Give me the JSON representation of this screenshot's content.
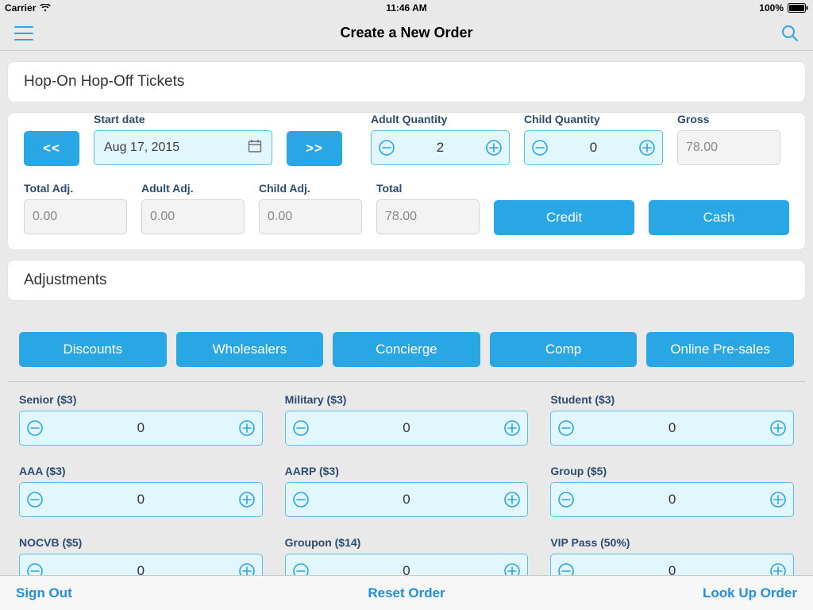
{
  "status": {
    "carrier": "Carrier",
    "time": "11:46 AM",
    "battery": "100%"
  },
  "nav": {
    "title": "Create a New Order"
  },
  "ticketsCard": {
    "title": "Hop-On Hop-Off Tickets",
    "labels": {
      "start_date": "Start date",
      "adult_qty": "Adult Quantity",
      "child_qty": "Child Quantity",
      "gross": "Gross",
      "total_adj": "Total Adj.",
      "adult_adj": "Adult Adj.",
      "child_adj": "Child Adj.",
      "total": "Total",
      "credit": "Credit",
      "cash": "Cash",
      "prev": "<<",
      "next": ">>"
    },
    "values": {
      "start_date": "Aug 17, 2015",
      "adult_qty": "2",
      "child_qty": "0",
      "gross": "78.00",
      "total_adj": "0.00",
      "adult_adj": "0.00",
      "child_adj": "0.00",
      "total": "78.00"
    }
  },
  "adjustments": {
    "title": "Adjustments",
    "tabs": [
      "Discounts",
      "Wholesalers",
      "Concierge",
      "Comp",
      "Online Pre-sales"
    ],
    "items": [
      {
        "label": "Senior ($3)",
        "value": "0"
      },
      {
        "label": "Military ($3)",
        "value": "0"
      },
      {
        "label": "Student ($3)",
        "value": "0"
      },
      {
        "label": "AAA ($3)",
        "value": "0"
      },
      {
        "label": "AARP ($3)",
        "value": "0"
      },
      {
        "label": "Group ($5)",
        "value": "0"
      },
      {
        "label": "NOCVB ($5)",
        "value": "0"
      },
      {
        "label": "Groupon ($14)",
        "value": "0"
      },
      {
        "label": "VIP Pass (50%)",
        "value": "0"
      }
    ]
  },
  "toolbar": {
    "sign_out": "Sign Out",
    "reset": "Reset Order",
    "lookup": "Look Up Order"
  }
}
